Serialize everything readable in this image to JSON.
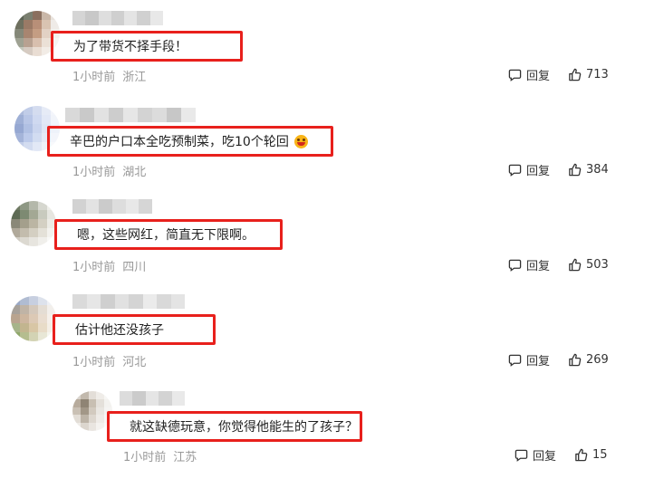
{
  "comments": [
    {
      "text": "为了带货不择手段！",
      "time": "1小时前",
      "location": "浙江",
      "reply_label": "回复",
      "likes": "713",
      "emoji": ""
    },
    {
      "text": "辛巴的户口本全吃预制菜，吃10个轮回",
      "time": "1小时前",
      "location": "湖北",
      "reply_label": "回复",
      "likes": "384",
      "emoji": "laughing-emoji"
    },
    {
      "text": "嗯，这些网红，简直无下限啊。",
      "time": "1小时前",
      "location": "四川",
      "reply_label": "回复",
      "likes": "503",
      "emoji": ""
    },
    {
      "text": "估计他还没孩子",
      "time": "1小时前",
      "location": "河北",
      "reply_label": "回复",
      "likes": "269",
      "emoji": ""
    },
    {
      "text": "就这缺德玩意，你觉得他能生的了孩子？",
      "time": "1小时前",
      "location": "江苏",
      "reply_label": "回复",
      "likes": "15",
      "emoji": ""
    }
  ],
  "colors": {
    "highlight_border": "#e8201c",
    "meta_text": "#999999",
    "body_text": "#222222"
  },
  "icons": {
    "reply": "reply-bubble-icon",
    "like": "thumbs-up-icon"
  }
}
